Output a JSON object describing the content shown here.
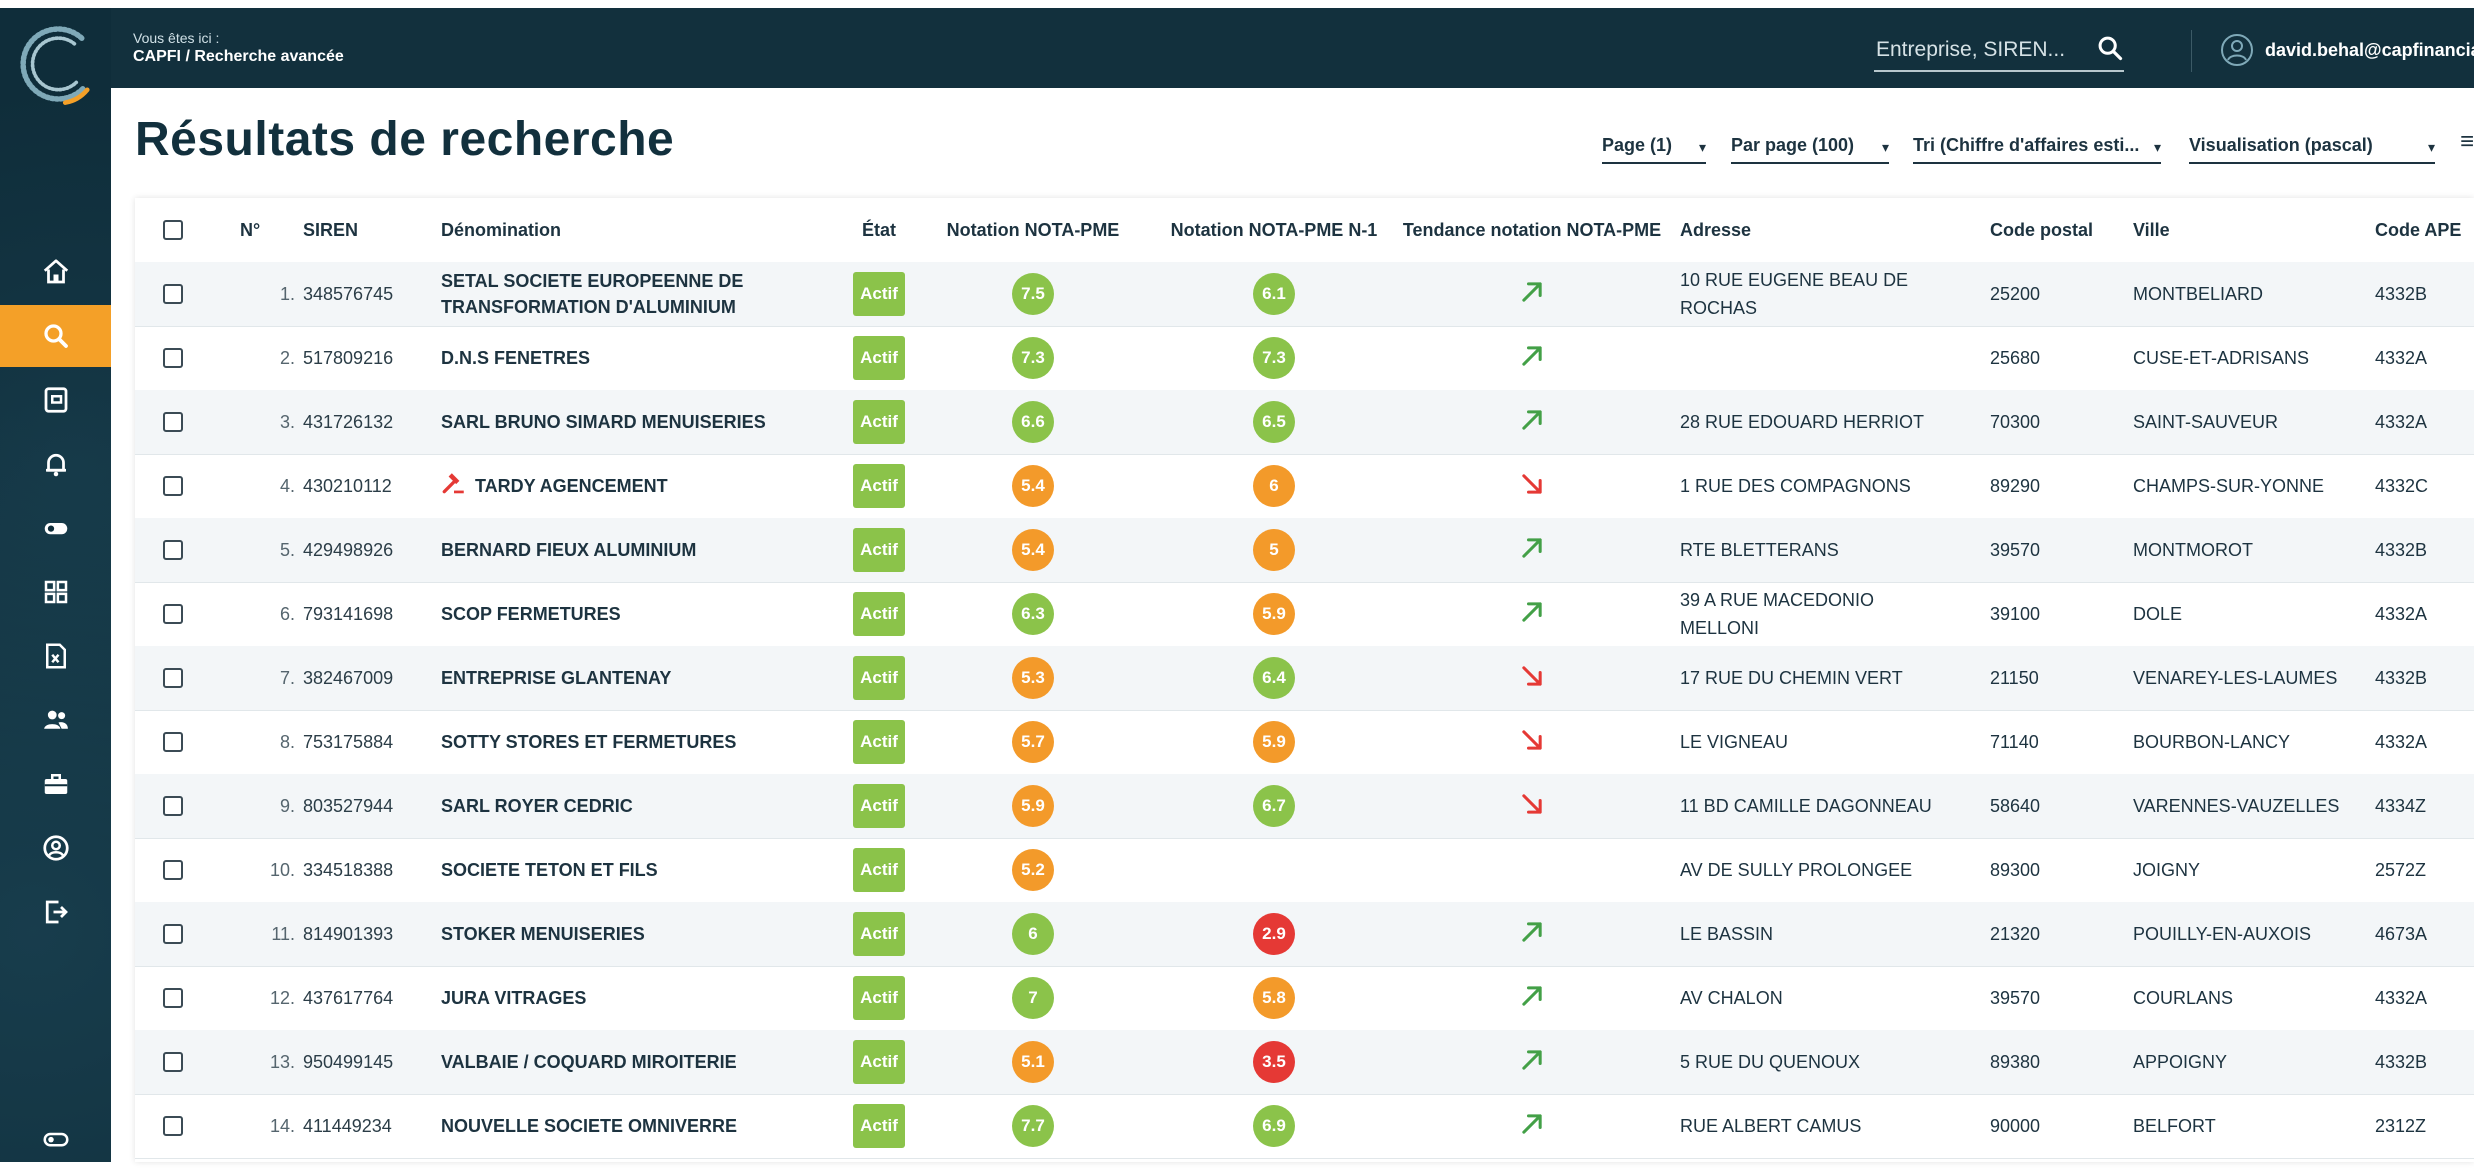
{
  "header": {
    "breadcrumb_label": "Vous êtes ici :",
    "breadcrumb_path": "CAPFI / Recherche avancée",
    "search_placeholder": "Entreprise, SIREN...",
    "user_email": "david.behal@capfinancia"
  },
  "page": {
    "title": "Résultats de recherche"
  },
  "controls": {
    "page": "Page (1)",
    "per_page": "Par page (100)",
    "sort": "Tri (Chiffre d'affaires esti...",
    "view": "Visualisation (pascal)"
  },
  "sidebar": {
    "items": [
      {
        "icon": "home-icon",
        "active": false
      },
      {
        "icon": "search-icon",
        "active": true
      },
      {
        "icon": "document-icon",
        "active": false
      },
      {
        "icon": "bell-icon",
        "active": false
      },
      {
        "icon": "toggle-icon",
        "active": false
      },
      {
        "icon": "grid-icon",
        "active": false
      },
      {
        "icon": "excel-icon",
        "active": false
      },
      {
        "icon": "users-icon",
        "active": false
      },
      {
        "icon": "briefcase-icon",
        "active": false
      },
      {
        "icon": "account-icon",
        "active": false
      },
      {
        "icon": "logout-icon",
        "active": false
      }
    ],
    "bottom_icon": "toggle-icon"
  },
  "colors": {
    "navy": "#12303d",
    "accent": "#f4a028",
    "green": "#8bc34a",
    "orange": "#f39a2a",
    "red": "#e53935"
  },
  "table": {
    "columns": [
      "N°",
      "SIREN",
      "Dénomination",
      "État",
      "Notation NOTA-PME",
      "Notation NOTA-PME N-1",
      "Tendance notation NOTA-PME",
      "Adresse",
      "Code postal",
      "Ville",
      "Code APE"
    ],
    "rows": [
      {
        "n": "1.",
        "siren": "348576745",
        "name": "SETAL SOCIETE EUROPEENNE DE TRANSFORMATION D'ALUMINIUM",
        "etat": "Actif",
        "note": "7.5",
        "note_color": "green",
        "note1": "6.1",
        "note1_color": "green",
        "trend": "up",
        "adresse": "10 RUE EUGENE BEAU DE ROCHAS",
        "cp": "25200",
        "ville": "MONTBELIARD",
        "ape": "4332B",
        "icon": ""
      },
      {
        "n": "2.",
        "siren": "517809216",
        "name": "D.N.S FENETRES",
        "etat": "Actif",
        "note": "7.3",
        "note_color": "green",
        "note1": "7.3",
        "note1_color": "green",
        "trend": "up",
        "adresse": "",
        "cp": "25680",
        "ville": "CUSE-ET-ADRISANS",
        "ape": "4332A",
        "icon": ""
      },
      {
        "n": "3.",
        "siren": "431726132",
        "name": "SARL BRUNO SIMARD MENUISERIES",
        "etat": "Actif",
        "note": "6.6",
        "note_color": "green",
        "note1": "6.5",
        "note1_color": "green",
        "trend": "up",
        "adresse": "28 RUE EDOUARD HERRIOT",
        "cp": "70300",
        "ville": "SAINT-SAUVEUR",
        "ape": "4332A",
        "icon": ""
      },
      {
        "n": "4.",
        "siren": "430210112",
        "name": "TARDY AGENCEMENT",
        "etat": "Actif",
        "note": "5.4",
        "note_color": "orange",
        "note1": "6",
        "note1_color": "orange",
        "trend": "down",
        "adresse": "1 RUE DES COMPAGNONS",
        "cp": "89290",
        "ville": "CHAMPS-SUR-YONNE",
        "ape": "4332C",
        "icon": "gavel-icon"
      },
      {
        "n": "5.",
        "siren": "429498926",
        "name": "BERNARD FIEUX ALUMINIUM",
        "etat": "Actif",
        "note": "5.4",
        "note_color": "orange",
        "note1": "5",
        "note1_color": "orange",
        "trend": "up",
        "adresse": "RTE BLETTERANS",
        "cp": "39570",
        "ville": "MONTMOROT",
        "ape": "4332B",
        "icon": ""
      },
      {
        "n": "6.",
        "siren": "793141698",
        "name": "SCOP FERMETURES",
        "etat": "Actif",
        "note": "6.3",
        "note_color": "green",
        "note1": "5.9",
        "note1_color": "orange",
        "trend": "up",
        "adresse": "39 A RUE MACEDONIO MELLONI",
        "cp": "39100",
        "ville": "DOLE",
        "ape": "4332A",
        "icon": ""
      },
      {
        "n": "7.",
        "siren": "382467009",
        "name": "ENTREPRISE GLANTENAY",
        "etat": "Actif",
        "note": "5.3",
        "note_color": "orange",
        "note1": "6.4",
        "note1_color": "green",
        "trend": "down",
        "adresse": "17 RUE DU CHEMIN VERT",
        "cp": "21150",
        "ville": "VENAREY-LES-LAUMES",
        "ape": "4332B",
        "icon": ""
      },
      {
        "n": "8.",
        "siren": "753175884",
        "name": "SOTTY STORES ET FERMETURES",
        "etat": "Actif",
        "note": "5.7",
        "note_color": "orange",
        "note1": "5.9",
        "note1_color": "orange",
        "trend": "down",
        "adresse": "LE VIGNEAU",
        "cp": "71140",
        "ville": "BOURBON-LANCY",
        "ape": "4332A",
        "icon": ""
      },
      {
        "n": "9.",
        "siren": "803527944",
        "name": "SARL ROYER CEDRIC",
        "etat": "Actif",
        "note": "5.9",
        "note_color": "orange",
        "note1": "6.7",
        "note1_color": "green",
        "trend": "down",
        "adresse": "11 BD CAMILLE DAGONNEAU",
        "cp": "58640",
        "ville": "VARENNES-VAUZELLES",
        "ape": "4334Z",
        "icon": ""
      },
      {
        "n": "10.",
        "siren": "334518388",
        "name": "SOCIETE TETON ET FILS",
        "etat": "Actif",
        "note": "5.2",
        "note_color": "orange",
        "note1": "",
        "note1_color": "",
        "trend": "",
        "adresse": "AV DE SULLY PROLONGEE",
        "cp": "89300",
        "ville": "JOIGNY",
        "ape": "2572Z",
        "icon": ""
      },
      {
        "n": "11.",
        "siren": "814901393",
        "name": "STOKER MENUISERIES",
        "etat": "Actif",
        "note": "6",
        "note_color": "green",
        "note1": "2.9",
        "note1_color": "red",
        "trend": "up",
        "adresse": "LE BASSIN",
        "cp": "21320",
        "ville": "POUILLY-EN-AUXOIS",
        "ape": "4673A",
        "icon": ""
      },
      {
        "n": "12.",
        "siren": "437617764",
        "name": "JURA VITRAGES",
        "etat": "Actif",
        "note": "7",
        "note_color": "green",
        "note1": "5.8",
        "note1_color": "orange",
        "trend": "up",
        "adresse": "AV CHALON",
        "cp": "39570",
        "ville": "COURLANS",
        "ape": "4332A",
        "icon": ""
      },
      {
        "n": "13.",
        "siren": "950499145",
        "name": "VALBAIE / COQUARD MIROITERIE",
        "etat": "Actif",
        "note": "5.1",
        "note_color": "orange",
        "note1": "3.5",
        "note1_color": "red",
        "trend": "up",
        "adresse": "5 RUE DU QUENOUX",
        "cp": "89380",
        "ville": "APPOIGNY",
        "ape": "4332B",
        "icon": ""
      },
      {
        "n": "14.",
        "siren": "411449234",
        "name": "NOUVELLE SOCIETE OMNIVERRE",
        "etat": "Actif",
        "note": "7.7",
        "note_color": "green",
        "note1": "6.9",
        "note1_color": "green",
        "trend": "up",
        "adresse": "RUE ALBERT CAMUS",
        "cp": "90000",
        "ville": "BELFORT",
        "ape": "2312Z",
        "icon": ""
      }
    ]
  }
}
